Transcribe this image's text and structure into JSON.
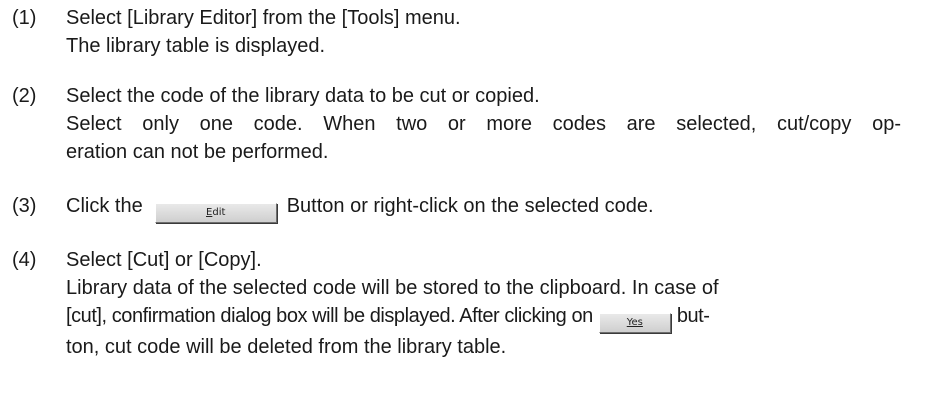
{
  "steps": [
    {
      "number": "(1)",
      "lines": [
        "Select [Library Editor] from the [Tools] menu.",
        "The library table is displayed."
      ]
    },
    {
      "number": "(2)",
      "lines": [
        "Select the code of the library data to be cut or copied.",
        "Select only one code. When two or more codes are selected, cut/copy op-",
        "eration can not be performed."
      ]
    },
    {
      "number": "(3)",
      "pre": "Click the",
      "button_label_underlined": "E",
      "button_label_rest": "dit",
      "post": "Button or right-click on the selected code."
    },
    {
      "number": "(4)",
      "line1": "Select [Cut] or [Copy].",
      "line2": "Library data of the selected code will be stored to the clipboard. In case of",
      "line3_pre": "[cut], confirmation dialog box will be displayed. After clicking on",
      "yes_button_label": "Yes",
      "line3_post": "but-",
      "line4": "ton, cut code will be deleted from the library table."
    }
  ]
}
